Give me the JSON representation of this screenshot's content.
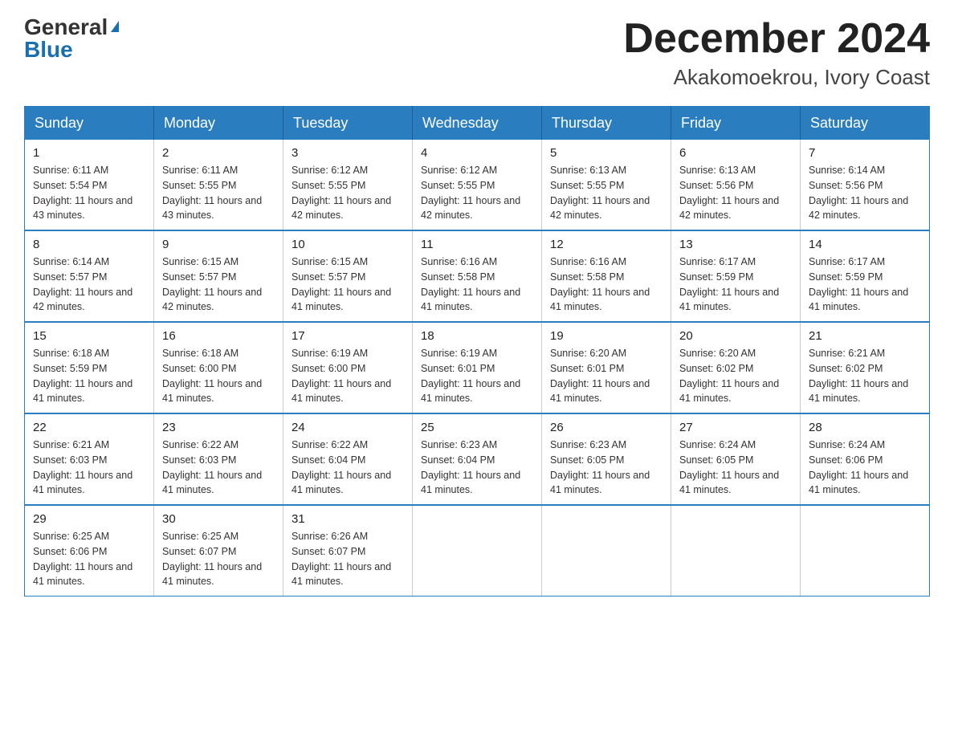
{
  "logo": {
    "general": "General",
    "blue": "Blue"
  },
  "title": "December 2024",
  "location": "Akakomoekrou, Ivory Coast",
  "weekdays": [
    "Sunday",
    "Monday",
    "Tuesday",
    "Wednesday",
    "Thursday",
    "Friday",
    "Saturday"
  ],
  "weeks": [
    [
      {
        "day": "1",
        "sunrise": "6:11 AM",
        "sunset": "5:54 PM",
        "daylight": "11 hours and 43 minutes."
      },
      {
        "day": "2",
        "sunrise": "6:11 AM",
        "sunset": "5:55 PM",
        "daylight": "11 hours and 43 minutes."
      },
      {
        "day": "3",
        "sunrise": "6:12 AM",
        "sunset": "5:55 PM",
        "daylight": "11 hours and 42 minutes."
      },
      {
        "day": "4",
        "sunrise": "6:12 AM",
        "sunset": "5:55 PM",
        "daylight": "11 hours and 42 minutes."
      },
      {
        "day": "5",
        "sunrise": "6:13 AM",
        "sunset": "5:55 PM",
        "daylight": "11 hours and 42 minutes."
      },
      {
        "day": "6",
        "sunrise": "6:13 AM",
        "sunset": "5:56 PM",
        "daylight": "11 hours and 42 minutes."
      },
      {
        "day": "7",
        "sunrise": "6:14 AM",
        "sunset": "5:56 PM",
        "daylight": "11 hours and 42 minutes."
      }
    ],
    [
      {
        "day": "8",
        "sunrise": "6:14 AM",
        "sunset": "5:57 PM",
        "daylight": "11 hours and 42 minutes."
      },
      {
        "day": "9",
        "sunrise": "6:15 AM",
        "sunset": "5:57 PM",
        "daylight": "11 hours and 42 minutes."
      },
      {
        "day": "10",
        "sunrise": "6:15 AM",
        "sunset": "5:57 PM",
        "daylight": "11 hours and 41 minutes."
      },
      {
        "day": "11",
        "sunrise": "6:16 AM",
        "sunset": "5:58 PM",
        "daylight": "11 hours and 41 minutes."
      },
      {
        "day": "12",
        "sunrise": "6:16 AM",
        "sunset": "5:58 PM",
        "daylight": "11 hours and 41 minutes."
      },
      {
        "day": "13",
        "sunrise": "6:17 AM",
        "sunset": "5:59 PM",
        "daylight": "11 hours and 41 minutes."
      },
      {
        "day": "14",
        "sunrise": "6:17 AM",
        "sunset": "5:59 PM",
        "daylight": "11 hours and 41 minutes."
      }
    ],
    [
      {
        "day": "15",
        "sunrise": "6:18 AM",
        "sunset": "5:59 PM",
        "daylight": "11 hours and 41 minutes."
      },
      {
        "day": "16",
        "sunrise": "6:18 AM",
        "sunset": "6:00 PM",
        "daylight": "11 hours and 41 minutes."
      },
      {
        "day": "17",
        "sunrise": "6:19 AM",
        "sunset": "6:00 PM",
        "daylight": "11 hours and 41 minutes."
      },
      {
        "day": "18",
        "sunrise": "6:19 AM",
        "sunset": "6:01 PM",
        "daylight": "11 hours and 41 minutes."
      },
      {
        "day": "19",
        "sunrise": "6:20 AM",
        "sunset": "6:01 PM",
        "daylight": "11 hours and 41 minutes."
      },
      {
        "day": "20",
        "sunrise": "6:20 AM",
        "sunset": "6:02 PM",
        "daylight": "11 hours and 41 minutes."
      },
      {
        "day": "21",
        "sunrise": "6:21 AM",
        "sunset": "6:02 PM",
        "daylight": "11 hours and 41 minutes."
      }
    ],
    [
      {
        "day": "22",
        "sunrise": "6:21 AM",
        "sunset": "6:03 PM",
        "daylight": "11 hours and 41 minutes."
      },
      {
        "day": "23",
        "sunrise": "6:22 AM",
        "sunset": "6:03 PM",
        "daylight": "11 hours and 41 minutes."
      },
      {
        "day": "24",
        "sunrise": "6:22 AM",
        "sunset": "6:04 PM",
        "daylight": "11 hours and 41 minutes."
      },
      {
        "day": "25",
        "sunrise": "6:23 AM",
        "sunset": "6:04 PM",
        "daylight": "11 hours and 41 minutes."
      },
      {
        "day": "26",
        "sunrise": "6:23 AM",
        "sunset": "6:05 PM",
        "daylight": "11 hours and 41 minutes."
      },
      {
        "day": "27",
        "sunrise": "6:24 AM",
        "sunset": "6:05 PM",
        "daylight": "11 hours and 41 minutes."
      },
      {
        "day": "28",
        "sunrise": "6:24 AM",
        "sunset": "6:06 PM",
        "daylight": "11 hours and 41 minutes."
      }
    ],
    [
      {
        "day": "29",
        "sunrise": "6:25 AM",
        "sunset": "6:06 PM",
        "daylight": "11 hours and 41 minutes."
      },
      {
        "day": "30",
        "sunrise": "6:25 AM",
        "sunset": "6:07 PM",
        "daylight": "11 hours and 41 minutes."
      },
      {
        "day": "31",
        "sunrise": "6:26 AM",
        "sunset": "6:07 PM",
        "daylight": "11 hours and 41 minutes."
      },
      null,
      null,
      null,
      null
    ]
  ],
  "labels": {
    "sunrise": "Sunrise:",
    "sunset": "Sunset:",
    "daylight": "Daylight:"
  }
}
